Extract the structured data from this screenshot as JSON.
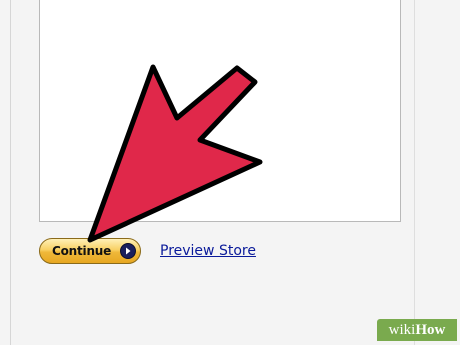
{
  "buttons": {
    "continue_label": "Continue"
  },
  "links": {
    "preview_store": "Preview Store"
  },
  "watermark": {
    "wiki": "wiki",
    "how": "How"
  },
  "colors": {
    "arrow_fill": "#e0284a",
    "arrow_outline": "#000000",
    "link": "#0a1a9a",
    "button_gold": "#f3c24a",
    "watermark_bg": "#7aaa4e"
  },
  "icons": {
    "continue_arrow": "circle-chevron-right-icon",
    "pointer": "red-pointer-arrow-icon"
  }
}
